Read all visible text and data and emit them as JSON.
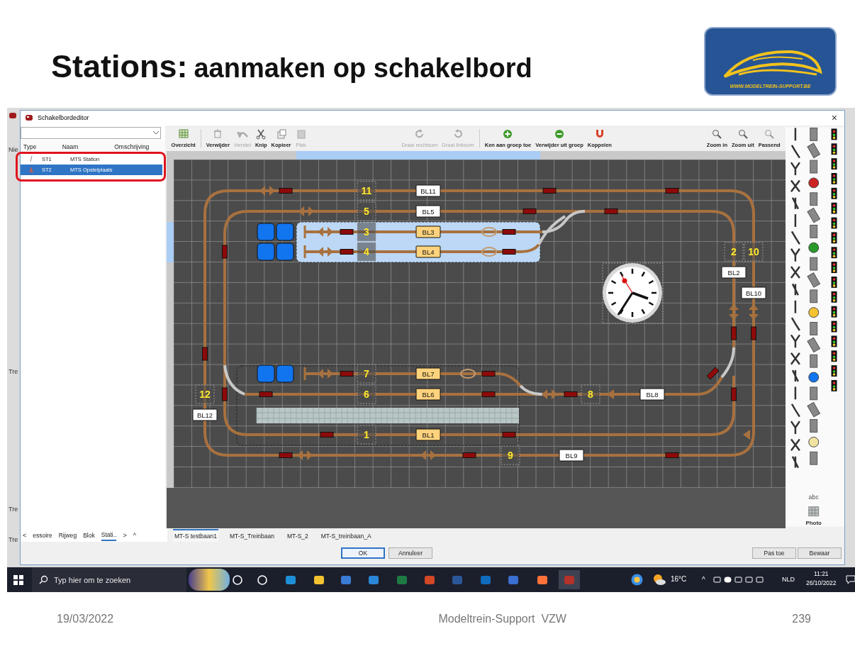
{
  "slide": {
    "title_lead": "Stations:",
    "title_rest": "aanmaken op schakelbord",
    "logo_text": "WWW.MODELTREIN-SUPPORT.BE"
  },
  "background_window": {
    "labels": [
      "Nie",
      "Tre",
      "Tre",
      "Tre"
    ]
  },
  "window": {
    "title": "Schakelbordeditor",
    "close": "×"
  },
  "station_list": {
    "columns": [
      "Type",
      "Naam",
      "Omschrijving"
    ],
    "rows": [
      {
        "name": "ST1",
        "description": "MTS Station",
        "selected": false
      },
      {
        "name": "ST2",
        "description": "MTS Opstelplaats",
        "selected": true
      }
    ]
  },
  "toolbar": {
    "sections": [
      [
        [
          {
            "label": "Overzicht",
            "disabled": false
          }
        ],
        [
          {
            "label": "Verwijder",
            "disabled": false
          },
          {
            "label": "Herstel",
            "disabled": true
          },
          {
            "label": "Knip",
            "disabled": false
          },
          {
            "label": "Kopieer",
            "disabled": false
          },
          {
            "label": "Plak",
            "disabled": true
          }
        ]
      ],
      [
        [
          {
            "label": "Draai rechtsom",
            "disabled": true
          },
          {
            "label": "Draai linksom",
            "disabled": true
          }
        ],
        [
          {
            "label": "Ken aan groep toe",
            "disabled": false
          },
          {
            "label": "Verwijder uit groep",
            "disabled": false
          },
          {
            "label": "Koppelen",
            "disabled": false
          }
        ]
      ],
      [
        [
          {
            "label": "Zoom in",
            "disabled": false
          },
          {
            "label": "Zoom uit",
            "disabled": false
          },
          {
            "label": "Passend",
            "disabled": false
          }
        ]
      ]
    ]
  },
  "canvas": {
    "numbers": [
      "11",
      "5",
      "3",
      "4",
      "2",
      "10",
      "7",
      "12",
      "6",
      "8",
      "1",
      "9"
    ],
    "names": [
      {
        "name": "BL11",
        "in_station": false
      },
      {
        "name": "BL5",
        "in_station": false
      },
      {
        "name": "BL3",
        "in_station": true
      },
      {
        "name": "BL4",
        "in_station": true
      },
      {
        "name": "BL2",
        "in_station": false
      },
      {
        "name": "BL10",
        "in_station": false
      },
      {
        "name": "BL7",
        "in_station": true
      },
      {
        "name": "BL6",
        "in_station": true
      },
      {
        "name": "BL8",
        "in_station": false
      },
      {
        "name": "BL12",
        "in_station": false
      },
      {
        "name": "BL1",
        "in_station": true
      },
      {
        "name": "BL9",
        "in_station": false
      }
    ]
  },
  "palette": {
    "text_tool": "abc",
    "photo_tool": "Photo"
  },
  "left_tabs": {
    "scroll_left": "<",
    "scroll_right": ">",
    "collapse": "^",
    "tabs": [
      {
        "label": "essoire",
        "selected": false
      },
      {
        "label": "Rijweg",
        "selected": false
      },
      {
        "label": "Blok",
        "selected": false
      },
      {
        "label": "Stati..",
        "selected": true
      }
    ]
  },
  "layout_tabs": [
    {
      "label": "MT-S testbaan1",
      "selected": true
    },
    {
      "label": "MT-S_Treinbaan",
      "selected": false
    },
    {
      "label": "MT-S_2",
      "selected": false
    },
    {
      "label": "MT-S_treinbaan_A",
      "selected": false
    }
  ],
  "buttons": [
    {
      "label": "OK",
      "default": true
    },
    {
      "label": "Annuleer",
      "default": false
    }
  ],
  "right_buttons": [
    {
      "label": "Pas toe",
      "default": false
    },
    {
      "label": "Bewaar",
      "default": false
    }
  ],
  "taskbar": {
    "search_placeholder": "Typ hier om te zoeken",
    "apps": [
      {
        "selected": false
      },
      {
        "selected": false
      },
      {
        "selected": false
      },
      {
        "selected": false
      },
      {
        "selected": false
      },
      {
        "selected": false
      },
      {
        "selected": false
      },
      {
        "selected": false
      },
      {
        "selected": false
      },
      {
        "selected": false
      },
      {
        "selected": false
      },
      {
        "selected": false
      },
      {
        "selected": true
      }
    ],
    "temperature": "16°C",
    "tray_chevron": "^",
    "language": "NLD",
    "time": "11:21",
    "date": "26/10/2022"
  },
  "footer": {
    "date": "19/03/2022",
    "organisation": "Modeltrein-Support  VZW",
    "page": "239"
  }
}
